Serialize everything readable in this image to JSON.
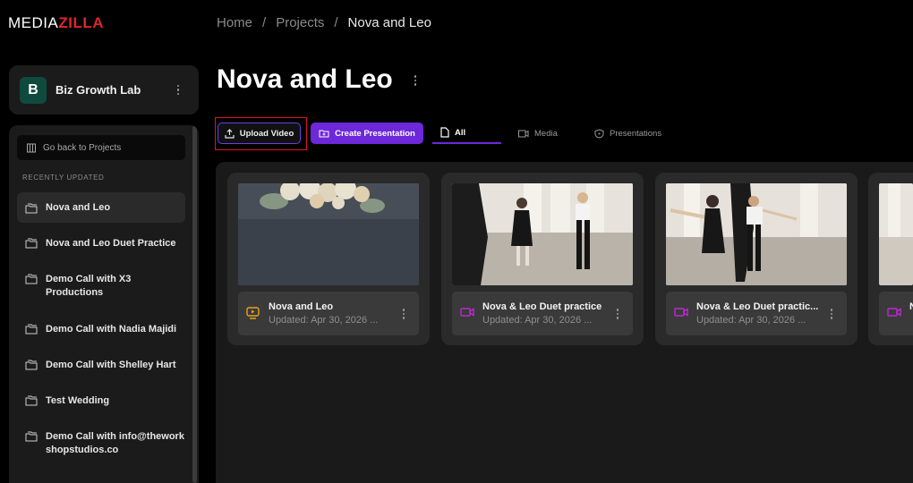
{
  "logo": {
    "part1": "MEDIA",
    "part2": "ZILLA"
  },
  "breadcrumb": {
    "home": "Home",
    "sep1": "/",
    "projects": "Projects",
    "sep2": "/",
    "current": "Nova and Leo"
  },
  "workspace": {
    "initial": "B",
    "name": "Biz Growth Lab"
  },
  "sidebar": {
    "back_label": "Go back to Projects",
    "section_label": "RECENTLY UPDATED",
    "items": [
      {
        "label": "Nova and Leo"
      },
      {
        "label": "Nova and Leo Duet Practice"
      },
      {
        "label": "Demo Call with X3 Productions"
      },
      {
        "label": "Demo Call with Nadia Majidi"
      },
      {
        "label": "Demo Call with Shelley Hart"
      },
      {
        "label": "Test Wedding"
      },
      {
        "label": "Demo Call with info@theworkshopstudios.co"
      }
    ]
  },
  "page": {
    "title": "Nova and Leo"
  },
  "toolbar": {
    "upload_label": "Upload Video",
    "create_label": "Create Presentation"
  },
  "tabs": {
    "all": "All",
    "media": "Media",
    "presentations": "Presentations"
  },
  "cards": [
    {
      "name": "Nova and Leo",
      "updated": "Updated: Apr 30, 2026 ...",
      "icon": "presentation-icon"
    },
    {
      "name": "Nova & Leo Duet practice",
      "updated": "Updated: Apr 30, 2026 ...",
      "icon": "video-icon"
    },
    {
      "name": "Nova & Leo Duet practic...",
      "updated": "Updated: Apr 30, 2026 ...",
      "icon": "video-icon"
    },
    {
      "name": "N",
      "updated": "",
      "icon": "video-icon"
    }
  ],
  "colors": {
    "accent": "#6d28d9",
    "brand_red": "#e0242b",
    "highlight": "#e0161e",
    "presentation_icon": "#e8a317",
    "video_icon": "#c026d3"
  }
}
